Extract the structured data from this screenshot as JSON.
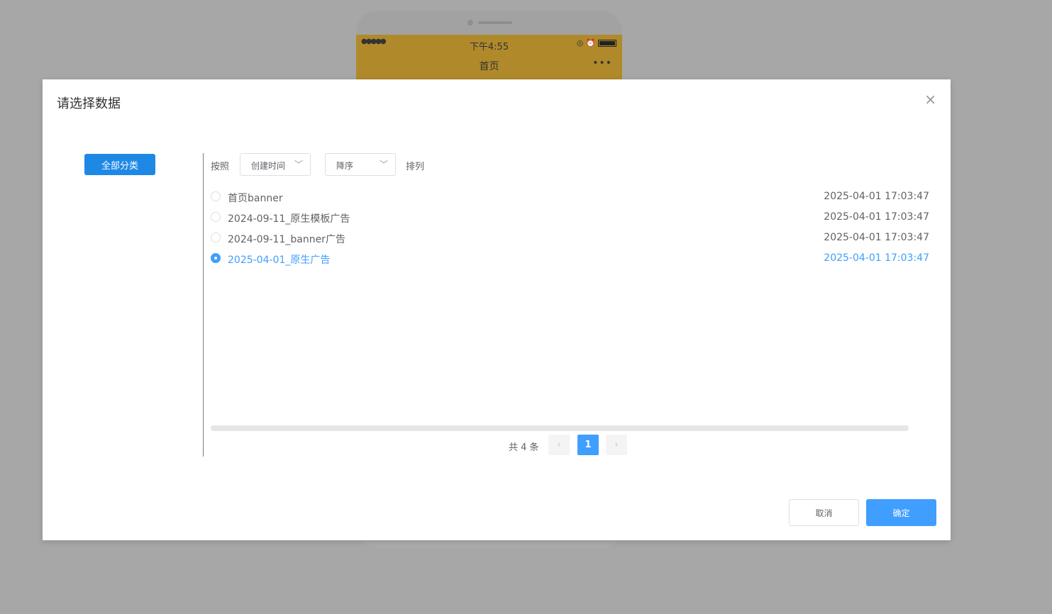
{
  "phone": {
    "signal": "●●●●●",
    "time": "下午4:55",
    "title": "首页",
    "more": "•••"
  },
  "modal": {
    "title": "请选择数据",
    "close_icon": "×",
    "category_button": "全部分类",
    "sort": {
      "prefix": "按照",
      "field": "创建时间",
      "order": "降序",
      "suffix": "排列"
    },
    "items": [
      {
        "name": "首页banner",
        "date": "2025-04-01 17:03:47",
        "selected": false
      },
      {
        "name": "2024-09-11_原生模板广告",
        "date": "2025-04-01 17:03:47",
        "selected": false
      },
      {
        "name": "2024-09-11_banner广告",
        "date": "2025-04-01 17:03:47",
        "selected": false
      },
      {
        "name": "2025-04-01_原生广告",
        "date": "2025-04-01 17:03:47",
        "selected": true
      }
    ],
    "pager": {
      "total": "共 4 条",
      "prev": "‹",
      "current": "1",
      "next": "›"
    },
    "cancel": "取消",
    "confirm": "确定"
  }
}
